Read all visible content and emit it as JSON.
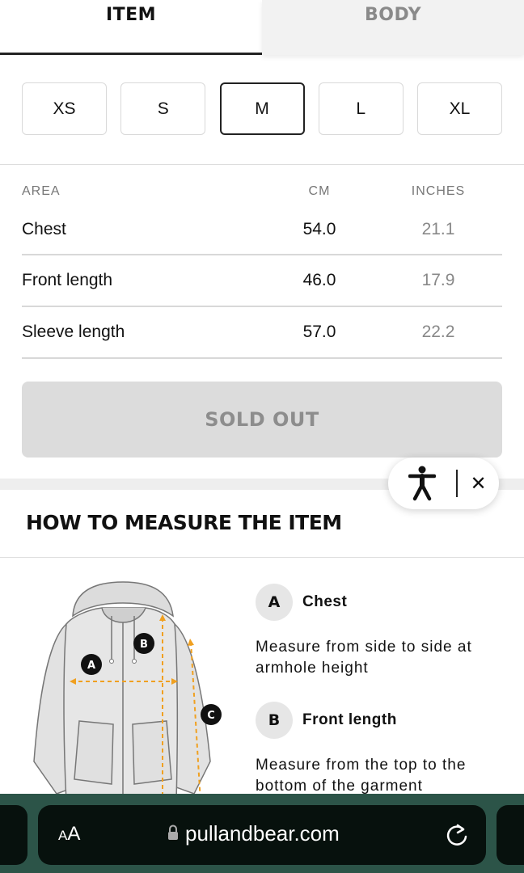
{
  "tabs": [
    {
      "label": "ITEM",
      "active": true
    },
    {
      "label": "BODY",
      "active": false
    }
  ],
  "sizes": {
    "options": [
      "XS",
      "S",
      "M",
      "L",
      "XL"
    ],
    "selected": "M"
  },
  "measurements": {
    "headers": {
      "area": "AREA",
      "cm": "CM",
      "inches": "INCHES"
    },
    "rows": [
      {
        "area": "Chest",
        "cm": "54.0",
        "inches": "21.1"
      },
      {
        "area": "Front length",
        "cm": "46.0",
        "inches": "17.9"
      },
      {
        "area": "Sleeve length",
        "cm": "57.0",
        "inches": "22.2"
      }
    ]
  },
  "sold_out_label": "SOLD OUT",
  "accessibility": {
    "close_label": "✕"
  },
  "how_to": {
    "title": "HOW TO MEASURE THE ITEM",
    "diagram_markers": [
      "A",
      "B",
      "C"
    ],
    "items": [
      {
        "badge": "A",
        "name": "Chest",
        "description": "Measure from side to side at armhole height"
      },
      {
        "badge": "B",
        "name": "Front length",
        "description": "Measure from the top to the bottom of the garment"
      }
    ]
  },
  "browser": {
    "text_size_label_small": "A",
    "text_size_label_large": "A",
    "url": "pullandbear.com"
  },
  "colors": {
    "accent": "#222222",
    "sold_out_bg": "#dcdcdc",
    "sold_out_text": "#8d8d8d",
    "measure_arrow": "#f0a020",
    "browser_bg": "#2c5448"
  }
}
